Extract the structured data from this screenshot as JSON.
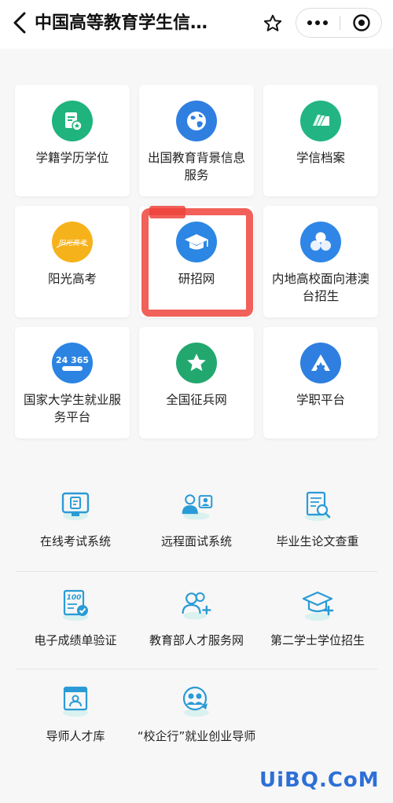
{
  "header": {
    "title": "中国高等教育学生信…"
  },
  "services": [
    {
      "label": "学籍学历学位",
      "icon": "document-badge-icon",
      "color": "#1fb37e"
    },
    {
      "label": "出国教育背景信息服务",
      "icon": "globe-icon",
      "color": "#2f7fe0"
    },
    {
      "label": "学信档案",
      "icon": "folder-stack-icon",
      "color": "#22b583"
    },
    {
      "label": "阳光高考",
      "icon": "sunshine-gaokao-logo",
      "color": "#f6b21a",
      "logo_text": "阳光高考"
    },
    {
      "label": "研招网",
      "icon": "graduation-cap-icon",
      "color": "#2c86e3"
    },
    {
      "label": "内地高校面向港澳台招生",
      "icon": "circles-cluster-icon",
      "color": "#2f86e6"
    },
    {
      "label": "国家大学生就业服务平台",
      "icon": "24365-logo",
      "color": "#2b84e2",
      "logo_text": "24 365"
    },
    {
      "label": "全国征兵网",
      "icon": "star-icon",
      "color": "#22a86f"
    },
    {
      "label": "学职平台",
      "icon": "letter-a-icon",
      "color": "#2f7fe0"
    }
  ],
  "tools": [
    {
      "label": "在线考试系统",
      "icon": "online-exam-icon"
    },
    {
      "label": "远程面试系统",
      "icon": "remote-interview-icon"
    },
    {
      "label": "毕业生论文查重",
      "icon": "thesis-check-icon"
    },
    {
      "label": "电子成绩单验证",
      "icon": "transcript-verify-icon"
    },
    {
      "label": "教育部人才服务网",
      "icon": "talent-service-icon"
    },
    {
      "label": "第二学士学位招生",
      "icon": "second-degree-icon"
    },
    {
      "label": "导师人才库",
      "icon": "mentor-database-icon"
    },
    {
      "label": "“校企行”就业创业导师",
      "icon": "career-mentor-icon"
    }
  ],
  "watermark": "UiBQ.CoM",
  "colors": {
    "annotation": "#ee443c",
    "tool_icon": "#2a9bd6",
    "tool_icon_bg": "#d9f1ef"
  }
}
